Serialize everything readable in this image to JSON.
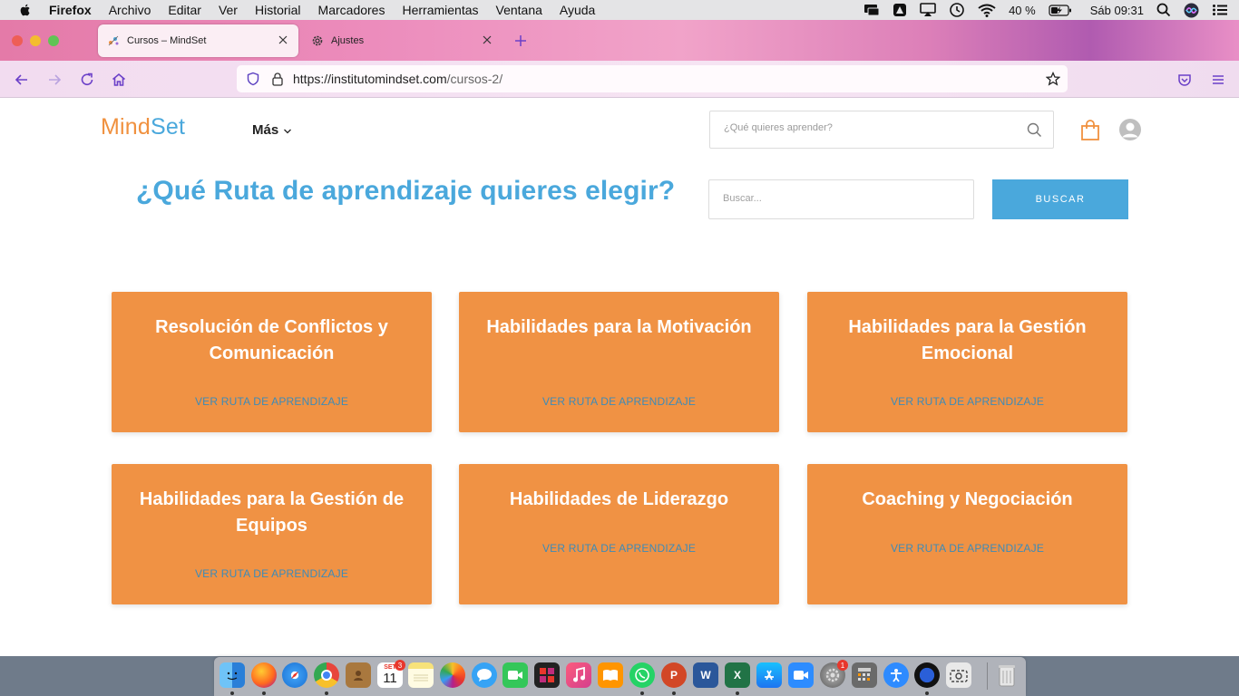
{
  "menubar": {
    "app_name": "Firefox",
    "items": [
      "Archivo",
      "Editar",
      "Ver",
      "Historial",
      "Marcadores",
      "Herramientas",
      "Ventana",
      "Ayuda"
    ],
    "battery": "40 %",
    "clock": "Sáb 09:31"
  },
  "browser": {
    "tabs": [
      {
        "title": "Cursos – MindSet",
        "active": true
      },
      {
        "title": "Ajustes",
        "active": false
      }
    ],
    "url": {
      "host": "https://institutomindset.com",
      "path": "/cursos-2/"
    }
  },
  "site": {
    "logo": {
      "part1": "Mind",
      "part2": "Set"
    },
    "nav_more": "Más",
    "header_search_placeholder": "¿Qué quieres aprender?",
    "headline": "¿Qué Ruta de aprendizaje quieres elegir?",
    "search_placeholder": "Buscar...",
    "search_button": "BUSCAR",
    "cards": [
      {
        "title": "Resolución de Conflictos y Comunicación",
        "link": "VER RUTA DE APRENDIZAJE"
      },
      {
        "title": "Habilidades para la Motivación",
        "link": "VER RUTA DE APRENDIZAJE"
      },
      {
        "title": "Habilidades para la Gestión Emocional",
        "link": "VER RUTA DE APRENDIZAJE"
      },
      {
        "title": "Habilidades para la Gestión de Equipos",
        "link": "VER RUTA DE APRENDIZAJE"
      },
      {
        "title": "Habilidades de Liderazgo",
        "link": "VER RUTA DE APRENDIZAJE"
      },
      {
        "title": "Coaching y Negociación",
        "link": "VER RUTA DE APRENDIZAJE"
      }
    ]
  },
  "dock": {
    "calendar_month": "SET",
    "calendar_day": "11",
    "calendar_badge": "3",
    "prefs_badge": "1",
    "word_letter": "W",
    "excel_letter": "X",
    "ppt_letter": "P"
  },
  "colors": {
    "accent_blue": "#4aa8dc",
    "card_orange": "#f09244",
    "logo_orange": "#f0913f"
  }
}
